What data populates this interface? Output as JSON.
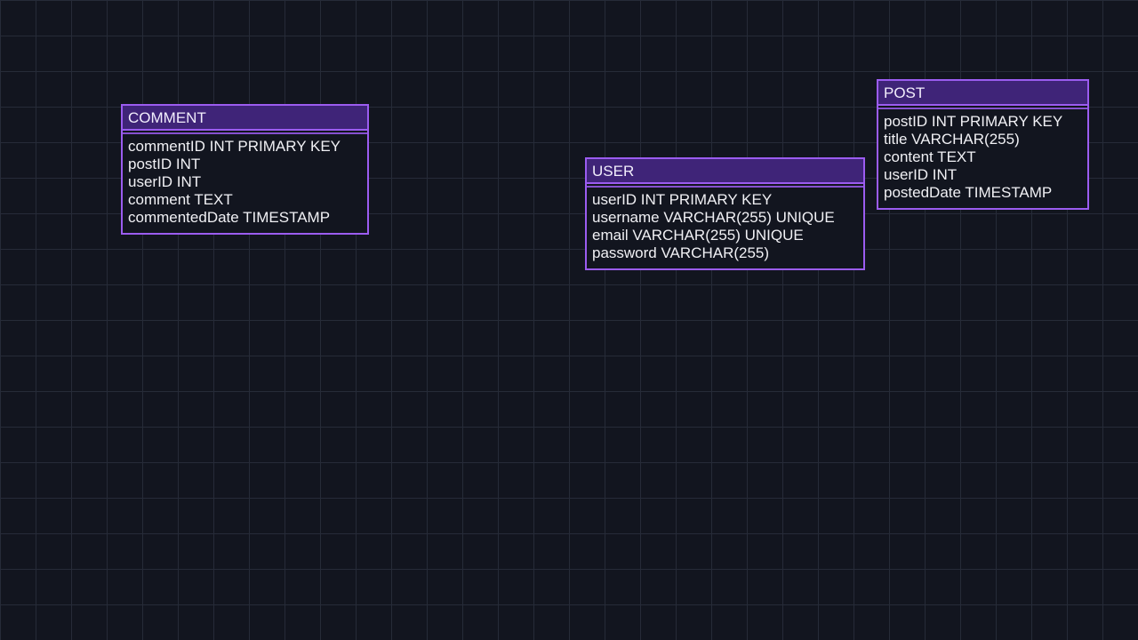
{
  "canvas": {
    "background_color": "#12151f",
    "grid_color": "#262b38",
    "accent_color": "#9b5cf0",
    "header_color": "#3f2478"
  },
  "entities": {
    "comment": {
      "name": "COMMENT",
      "fields": [
        "commentID INT PRIMARY KEY",
        "postID INT",
        "userID INT",
        "comment TEXT",
        "commentedDate TIMESTAMP"
      ]
    },
    "user": {
      "name": "USER",
      "fields": [
        "userID INT PRIMARY KEY",
        "username VARCHAR(255) UNIQUE",
        "email VARCHAR(255) UNIQUE",
        "password VARCHAR(255)"
      ]
    },
    "post": {
      "name": "POST",
      "fields": [
        "postID INT PRIMARY KEY",
        "title VARCHAR(255)",
        "content TEXT",
        "userID INT",
        "postedDate TIMESTAMP"
      ]
    }
  }
}
